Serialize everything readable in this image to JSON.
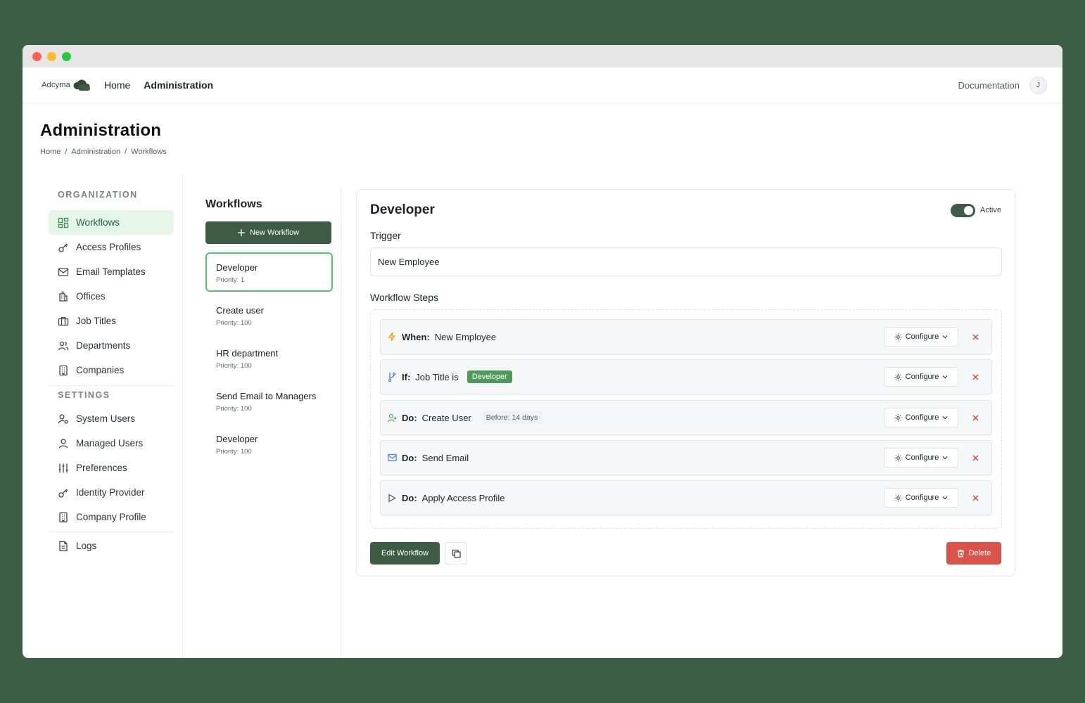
{
  "app": {
    "brand": "Adcyma"
  },
  "topnav": {
    "links": [
      "Home",
      "Administration"
    ],
    "documentation": "Documentation",
    "avatar_initial": "J"
  },
  "page": {
    "title": "Administration",
    "breadcrumb": [
      "Home",
      "/",
      "Administration",
      "/",
      "Workflows"
    ]
  },
  "sidebar": {
    "organization_label": "ORGANIZATION",
    "organization_items": [
      {
        "label": "Workflows",
        "icon": "grid-icon"
      },
      {
        "label": "Access Profiles",
        "icon": "key-icon"
      },
      {
        "label": "Email Templates",
        "icon": "mail-icon"
      },
      {
        "label": "Offices",
        "icon": "building-icon"
      },
      {
        "label": "Job Titles",
        "icon": "briefcase-icon"
      },
      {
        "label": "Departments",
        "icon": "users-icon"
      },
      {
        "label": "Companies",
        "icon": "office-icon"
      }
    ],
    "settings_label": "SETTINGS",
    "settings_items": [
      {
        "label": "System Users",
        "icon": "user-cog-icon"
      },
      {
        "label": "Managed Users",
        "icon": "user-icon"
      },
      {
        "label": "Preferences",
        "icon": "sliders-icon"
      },
      {
        "label": "Identity Provider",
        "icon": "key-icon"
      },
      {
        "label": "Company Profile",
        "icon": "office-icon"
      }
    ],
    "logs_label": "Logs"
  },
  "workflows": {
    "title": "Workflows",
    "new_button": "New Workflow",
    "items": [
      {
        "name": "Developer",
        "priority": "Priority: 1"
      },
      {
        "name": "Create user",
        "priority": "Priority: 100"
      },
      {
        "name": "HR department",
        "priority": "Priority: 100"
      },
      {
        "name": "Send Email to Managers",
        "priority": "Priority: 100"
      },
      {
        "name": "Developer",
        "priority": "Priority: 100"
      }
    ]
  },
  "detail": {
    "title": "Developer",
    "active_label": "Active",
    "trigger_label": "Trigger",
    "trigger_value": "New Employee",
    "steps_label": "Workflow Steps",
    "steps": [
      {
        "kind": "When:",
        "text": "New Employee",
        "icon": "lightning-icon"
      },
      {
        "kind": "If:",
        "text": "Job Title is",
        "tag": "Developer",
        "icon": "branch-icon"
      },
      {
        "kind": "Do:",
        "text": "Create User",
        "chip": "Before: 14 days",
        "icon": "user-plus-icon"
      },
      {
        "kind": "Do:",
        "text": "Send Email",
        "icon": "mail-icon"
      },
      {
        "kind": "Do:",
        "text": "Apply Access Profile",
        "icon": "play-icon"
      }
    ],
    "configure_label": "Configure",
    "edit_button": "Edit Workflow",
    "delete_button": "Delete"
  },
  "colors": {
    "background": "#3b5e44",
    "primary": "#3e5b43",
    "active_bg": "#e4f6e8",
    "selected_border": "#58c06d",
    "danger": "#d9534a",
    "tag": "#4f9a5a"
  }
}
